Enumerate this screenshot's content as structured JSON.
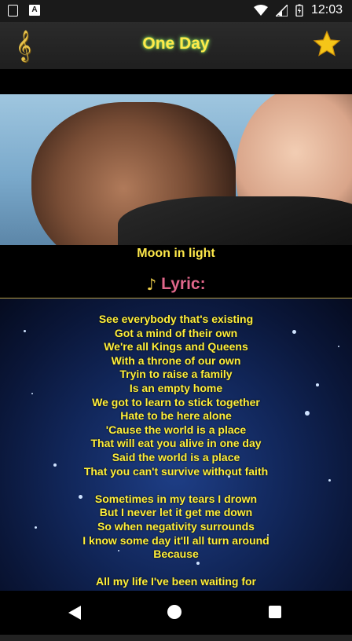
{
  "status_bar": {
    "time": "12:03"
  },
  "app_bar": {
    "title": "One Day"
  },
  "song": {
    "album": "Moon in light",
    "lyric_label": "Lyric:"
  },
  "lyrics": [
    "See everybody that's existing",
    "Got a mind of their own",
    "We're all Kings and Queens",
    "With a throne of our own",
    "Tryin to raise a family",
    "Is an empty home",
    "We got to learn to stick together",
    "Hate to be here alone",
    "'Cause the world is a place",
    "That will eat you alive in one day",
    "Said the world is a place",
    "That you can't survive without faith",
    "",
    "Sometimes in my tears I drown",
    "But I never let it get me down",
    "So when negativity surrounds",
    "I know some day it'll all turn around",
    "Because",
    "",
    "All my life I've been waiting for"
  ],
  "icons": {
    "clef": "treble-clef-icon",
    "favorite": "star-icon",
    "note": "music-note-icon",
    "nav_back": "back-triangle-icon",
    "nav_home": "home-circle-icon",
    "nav_recent": "recents-square-icon"
  },
  "colors": {
    "title": "#ffe94a",
    "lyric_text": "#ffef3a",
    "lyric_label": "#e0678a",
    "star": "#f5c518"
  }
}
